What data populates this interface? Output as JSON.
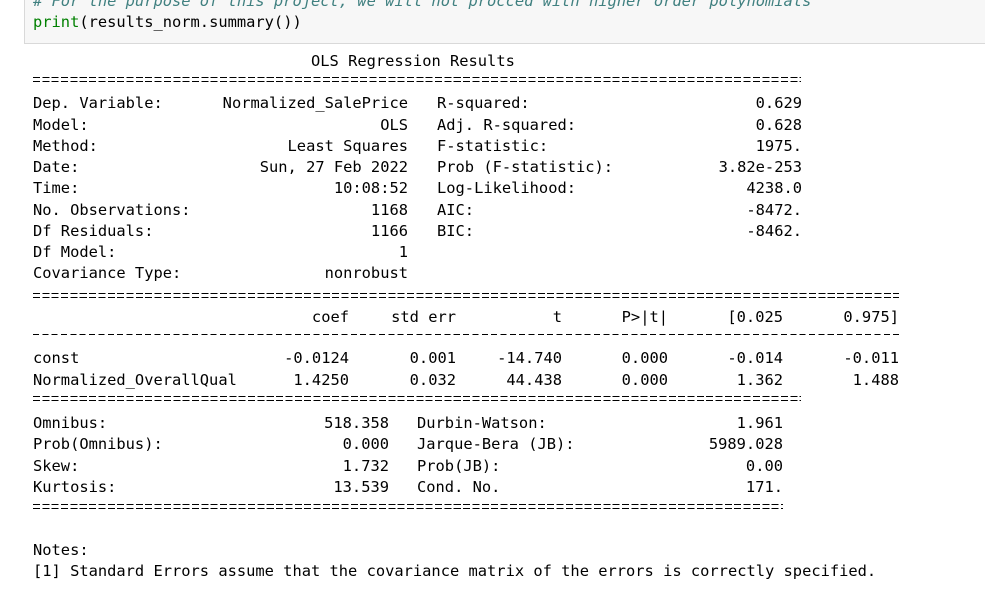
{
  "code_cell": {
    "comment_line": "# For the purpose of this project, we will not procced with higher order polynomials",
    "print_fn": "print",
    "call_args": "(results_norm.summary())"
  },
  "summary": {
    "title": "OLS Regression Results",
    "top_left": [
      {
        "label": "Dep. Variable:",
        "value": "Normalized_SalePrice"
      },
      {
        "label": "Model:",
        "value": "OLS"
      },
      {
        "label": "Method:",
        "value": "Least Squares"
      },
      {
        "label": "Date:",
        "value": "Sun, 27 Feb 2022"
      },
      {
        "label": "Time:",
        "value": "10:08:52"
      },
      {
        "label": "No. Observations:",
        "value": "1168"
      },
      {
        "label": "Df Residuals:",
        "value": "1166"
      },
      {
        "label": "Df Model:",
        "value": "1"
      },
      {
        "label": "Covariance Type:",
        "value": "nonrobust"
      }
    ],
    "top_right": [
      {
        "label": "R-squared:",
        "value": "0.629"
      },
      {
        "label": "Adj. R-squared:",
        "value": "0.628"
      },
      {
        "label": "F-statistic:",
        "value": "1975."
      },
      {
        "label": "Prob (F-statistic):",
        "value": "3.82e-253"
      },
      {
        "label": "Log-Likelihood:",
        "value": "4238.0"
      },
      {
        "label": "AIC:",
        "value": "-8472."
      },
      {
        "label": "BIC:",
        "value": "-8462."
      }
    ],
    "coef_headers": [
      "coef",
      "std err",
      "t",
      "P>|t|",
      "[0.025",
      "0.975]"
    ],
    "coef_rows": [
      {
        "name": "const",
        "values": [
          "-0.0124",
          "0.001",
          "-14.740",
          "0.000",
          "-0.014",
          "-0.011"
        ]
      },
      {
        "name": "Normalized_OverallQual",
        "values": [
          "1.4250",
          "0.032",
          "44.438",
          "0.000",
          "1.362",
          "1.488"
        ]
      }
    ],
    "diag_left": [
      {
        "label": "Omnibus:",
        "value": "518.358"
      },
      {
        "label": "Prob(Omnibus):",
        "value": "0.000"
      },
      {
        "label": "Skew:",
        "value": "1.732"
      },
      {
        "label": "Kurtosis:",
        "value": "13.539"
      }
    ],
    "diag_right": [
      {
        "label": "Durbin-Watson:",
        "value": "1.961"
      },
      {
        "label": "Jarque-Bera (JB):",
        "value": "5989.028"
      },
      {
        "label": "Prob(JB):",
        "value": "0.00"
      },
      {
        "label": "Cond. No.",
        "value": "171."
      }
    ],
    "notes_heading": "Notes:",
    "notes_line": "[1] Standard Errors assume that the covariance matrix of the errors is correctly specified."
  }
}
